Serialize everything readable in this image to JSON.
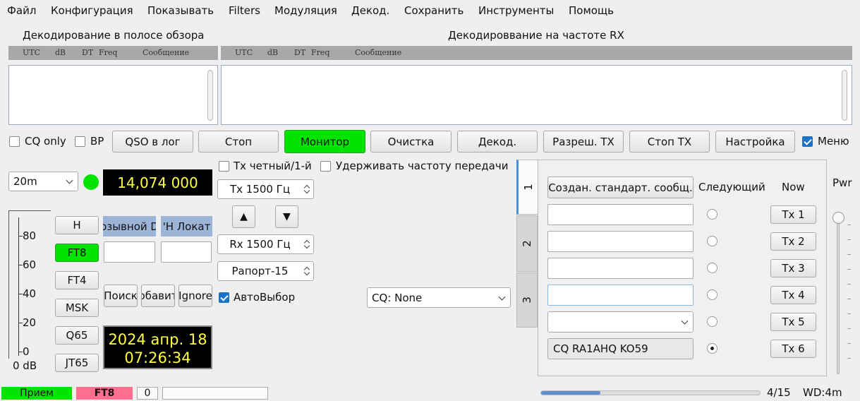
{
  "menu": [
    "Файл",
    "Конфигурация",
    "Показывать",
    "Filters",
    "Модуляция",
    "Декод.",
    "Сохранить",
    "Инструменты",
    "Помощь"
  ],
  "panels": {
    "band_title": "Декодирование в полосе обзора",
    "rx_title": "Декодироввание на частоте RX",
    "columns": [
      "UTC",
      "dB",
      "DT",
      "Freq",
      "Сообщение"
    ]
  },
  "buttons_row": {
    "cq_only": "CQ only",
    "bp": "BP",
    "qso_log": "QSO в лог",
    "stop": "Стоп",
    "monitor": "Монитор",
    "clear": "Очистка",
    "decode": "Декод.",
    "enable_tx": "Разреш. TX",
    "stop_tx": "Стоп TX",
    "settings": "Настройка",
    "menu": "Меню"
  },
  "band": {
    "value": "20m"
  },
  "frequency": "14,074 000",
  "tx_even": "Tx четный/1-й",
  "hold_tx": "Удерживать частоту передачи",
  "tx_freq": "Tx  1500  Гц",
  "rx_freq": "Rx  1500  Гц",
  "report": "Рапорт-15",
  "auto_select": "АвтоВыбор",
  "cq_select": "CQ: None",
  "up_arrow": "▲",
  "down_arrow": "▼",
  "modes": [
    "H",
    "FT8",
    "FT4",
    "MSK",
    "Q65",
    "JT65"
  ],
  "call_header": "озывной D",
  "locator_header": "'H Локат",
  "search": "Поиск",
  "add": "обавит",
  "ignore": "Ignore",
  "clock": {
    "date": "2024 апр. 18",
    "time": "07:26:34"
  },
  "meter": {
    "ticks": [
      "80",
      "60",
      "40",
      "20",
      "0"
    ],
    "label": "0 dB",
    "level": 0
  },
  "tabs": [
    "1",
    "2",
    "3"
  ],
  "tx_panel": {
    "gen_std": "Создан. стандарт. сообщ.",
    "next": "Следующий",
    "now": "Now",
    "tx_buttons": [
      "Tx 1",
      "Tx 2",
      "Tx 3",
      "Tx 4",
      "Tx 5",
      "Tx 6"
    ],
    "tx6_msg": "CQ RA1AHQ KO59",
    "selected_next": 6
  },
  "pwr": "Pwr",
  "status": {
    "state": "Прием",
    "mode": "FT8",
    "count": "0",
    "progress": "4/15",
    "wd": "WD:4m",
    "progress_fraction": 0.27
  },
  "colors": {
    "monitor_green": "#00e400",
    "mode_pink": "#ff6f8f",
    "freq_yellow": "#ffff44",
    "header_blue": "#9cb4d8"
  }
}
